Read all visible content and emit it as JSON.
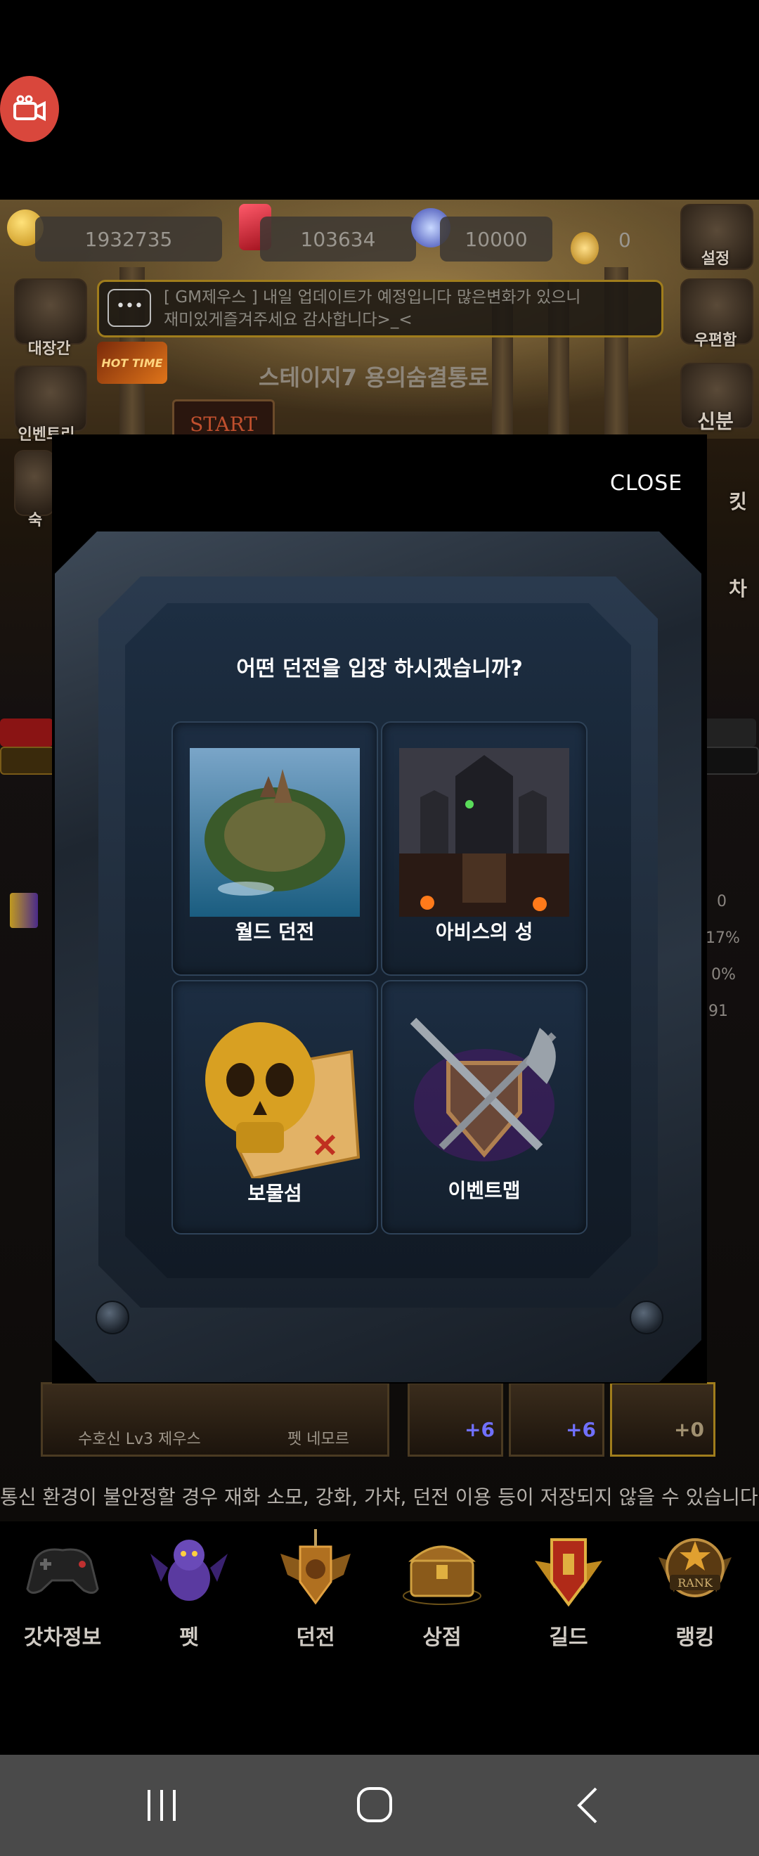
{
  "overlay": {
    "record_icon": "camera-record-icon"
  },
  "hud": {
    "gold": "1932735",
    "ruby": "103634",
    "star": "10000",
    "token": "0",
    "left_menu": [
      "대장간",
      "인벤토리",
      "숙"
    ],
    "right_menu": [
      "설정",
      "우편함",
      "신분",
      "킷",
      "차"
    ],
    "notice_line1": "[ GM제우스 ] 내일 업데이트가 예정입니다 많은변화가 있으니",
    "notice_line2": "재미있게즐겨주세요 감사합니다>_<",
    "hot_time": "HOT TIME",
    "stage_title": "스테이지7 용의숨결통로",
    "start_label": "START",
    "right_stats": [
      "0",
      "17%",
      "0%",
      "91"
    ],
    "guardian_caption": "수호신 Lv3  제우스",
    "pet_caption": "펫 네모르",
    "plus_values": [
      "+6",
      "+6",
      "+0"
    ]
  },
  "modal": {
    "close_label": "CLOSE",
    "title": "어떤 던전을 입장 하시겠습니까?",
    "options": [
      {
        "label": "월드 던전"
      },
      {
        "label": "아비스의 성"
      },
      {
        "label": "보물섬"
      },
      {
        "label": "이벤트맵"
      }
    ]
  },
  "warning": "통신 환경이 불안정할 경우 재화 소모, 강화, 가챠, 던전 이용 등이 저장되지 않을 수 있습니다...",
  "bottom_nav": [
    {
      "label": "갓차정보",
      "icon": "gamepad-icon"
    },
    {
      "label": "펫",
      "icon": "dragon-icon"
    },
    {
      "label": "던전",
      "icon": "dungeon-crest-icon"
    },
    {
      "label": "상점",
      "icon": "treasure-chest-icon"
    },
    {
      "label": "길드",
      "icon": "guild-crest-icon"
    },
    {
      "label": "랭킹",
      "icon": "rank-badge-icon"
    }
  ],
  "rank_badge_text": "RANK",
  "android_nav": [
    "recent-apps-icon",
    "home-icon",
    "back-icon"
  ],
  "colors": {
    "close_bg": "#000000",
    "frame": "#2a3542",
    "tile_bg": "#1c2d42",
    "notice_border": "#a07d1c"
  }
}
